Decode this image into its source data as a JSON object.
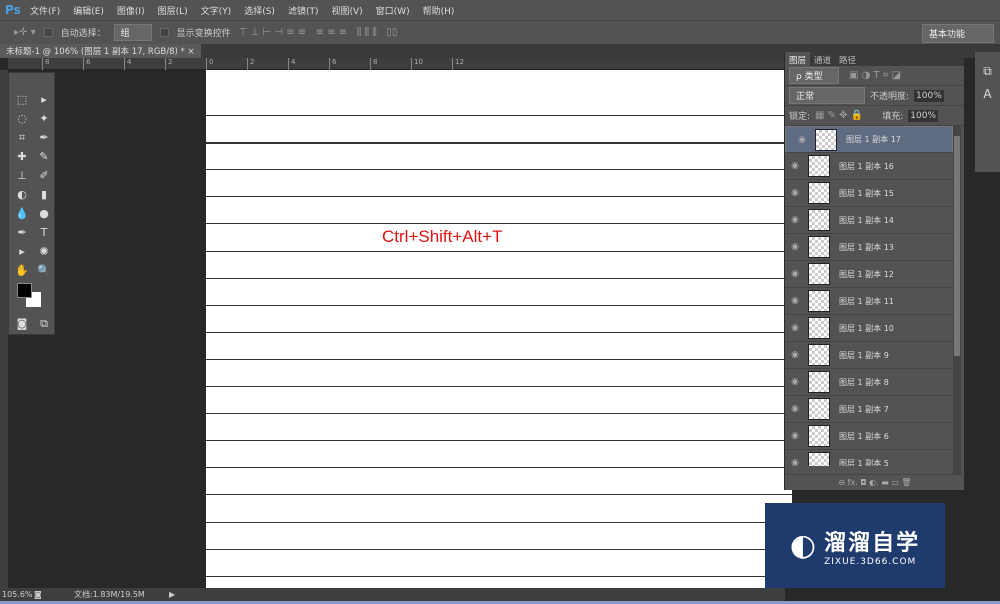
{
  "app": {
    "logo": "Ps",
    "menus": [
      "文件(F)",
      "编辑(E)",
      "图像(I)",
      "图层(L)",
      "文字(Y)",
      "选择(S)",
      "滤镜(T)",
      "视图(V)",
      "窗口(W)",
      "帮助(H)"
    ]
  },
  "options": {
    "auto_select_label": "自动选择：",
    "auto_select_value": "组",
    "show_transform_label": "显示变换控件",
    "workspace": "基本功能"
  },
  "document": {
    "tab_title": "未标题-1 @ 106% (图层 1 副本 17, RGB/8) *",
    "close": "×",
    "ruler_top": [
      "8",
      "6",
      "4",
      "2",
      "0",
      "2",
      "4",
      "6",
      "8",
      "10",
      "12"
    ],
    "overlay_text": "Ctrl+Shift+Alt+T"
  },
  "panel": {
    "tabs": [
      "图层",
      "通道",
      "路径"
    ],
    "filter_kind": "ρ 类型",
    "blend_mode": "正常",
    "opacity_label": "不透明度:",
    "opacity": "100%",
    "lock_label": "锁定:",
    "fill_label": "填充:",
    "fill": "100%",
    "layers": [
      "图层 1 副本 17",
      "图层 1 副本 16",
      "图层 1 副本 15",
      "图层 1 副本 14",
      "图层 1 副本 13",
      "图层 1 副本 12",
      "图层 1 副本 11",
      "图层 1 副本 10",
      "图层 1 副本 9",
      "图层 1 副本 8",
      "图层 1 副本 7",
      "图层 1 副本 6",
      "图层 1 副本 5"
    ],
    "selected_layer": "图层 1 副本 17",
    "footer_icons": "⊖ fx. ◘ ◐. ▬ ▭ 🗑"
  },
  "status": {
    "zoom": "105.6%",
    "doc": "文档:1.83M/19.5M"
  },
  "watermark": {
    "title": "溜溜自学",
    "url": "ZIXUE.3D66.COM"
  },
  "colors": {
    "overlay_text": "#e01010",
    "selected_layer": "#5f6b80",
    "watermark_bg": "#1f3b6e"
  }
}
